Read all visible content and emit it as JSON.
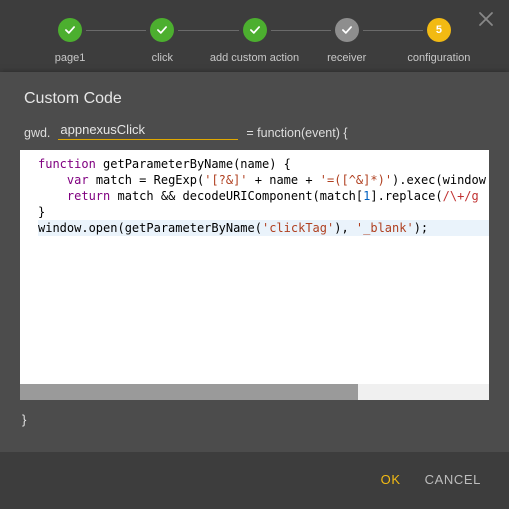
{
  "stepper": {
    "steps": [
      {
        "label": "page1",
        "state": "done"
      },
      {
        "label": "click",
        "state": "done"
      },
      {
        "label": "add custom action",
        "state": "done"
      },
      {
        "label": "receiver",
        "state": "neutral"
      },
      {
        "label": "configuration",
        "state": "current",
        "number": "5"
      }
    ]
  },
  "panel": {
    "title": "Custom Code",
    "prefix": "gwd.",
    "fn_name": "appnexusClick",
    "suffix": "= function(event) {",
    "closing": "}"
  },
  "code": {
    "l1": {
      "a": "function",
      "b": " getParameterByName(name) {"
    },
    "l2": {
      "a": "var",
      "b": " match = RegExp(",
      "c": "'[?&]'",
      "d": " + name + ",
      "e": "'=([^&]*)'",
      "f": ").exec(window"
    },
    "l3": {
      "a": "return",
      "b": " match && decodeURIComponent(match[",
      "c": "1",
      "d": "].replace(",
      "e": "/\\+/g"
    },
    "l4": "}",
    "l5": {
      "a": "window.open(getParameterByName(",
      "b": "'clickTag'",
      "c": "), ",
      "d": "'_blank'",
      "e": ");"
    }
  },
  "actions": {
    "ok": "OK",
    "cancel": "CANCEL"
  },
  "colors": {
    "accent": "#f2ba13",
    "step_done": "#4caf2f",
    "step_neutral": "#8e8e8e"
  }
}
